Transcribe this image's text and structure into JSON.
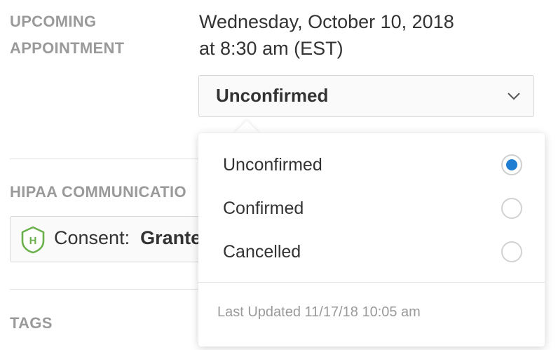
{
  "appointment": {
    "label": "UPCOMING APPOINTMENT",
    "date_line": "Wednesday, October 10, 2018",
    "time_line": "at 8:30 am (EST)"
  },
  "status_select": {
    "selected": "Unconfirmed",
    "icon": "chevron-down-icon"
  },
  "hipaa": {
    "label": "HIPAA COMMUNICATIO",
    "consent_prefix": "Consent:",
    "consent_value": "Grante",
    "icon": "shield-h-icon",
    "icon_color": "#6ab04c"
  },
  "tags": {
    "label": "TAGS"
  },
  "dropdown": {
    "options": [
      {
        "label": "Unconfirmed",
        "checked": true
      },
      {
        "label": "Confirmed",
        "checked": false
      },
      {
        "label": "Cancelled",
        "checked": false
      }
    ],
    "last_updated": "Last Updated 11/17/18 10:05 am",
    "accent_color": "#1f7ed1"
  }
}
